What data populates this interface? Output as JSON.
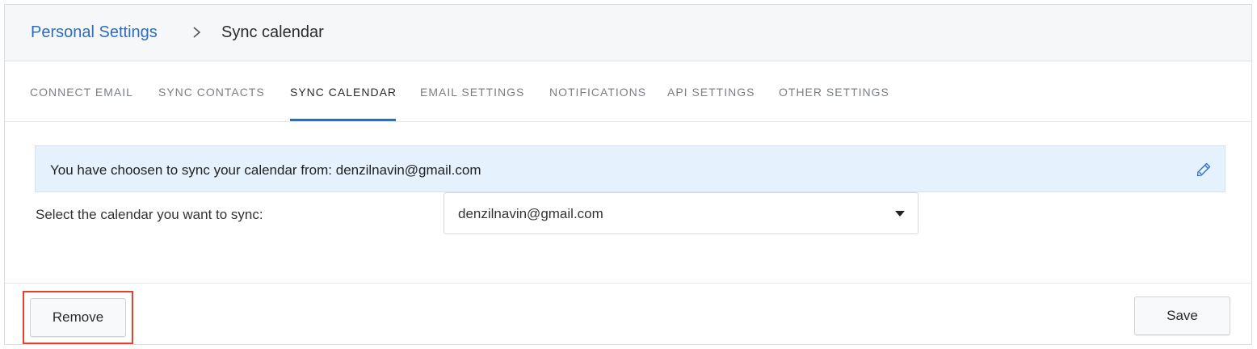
{
  "breadcrumb": {
    "parent_label": "Personal Settings",
    "current_label": "Sync calendar"
  },
  "tabs": [
    {
      "label": "CONNECT  EMAIL",
      "active": false
    },
    {
      "label": "SYNC  CONTACTS",
      "active": false
    },
    {
      "label": "SYNC  CALENDAR",
      "active": true
    },
    {
      "label": "EMAIL  SETTINGS",
      "active": false
    },
    {
      "label": "NOTIFICATIONS",
      "active": false
    },
    {
      "label": "API  SETTINGS",
      "active": false
    },
    {
      "label": "OTHER  SETTINGS",
      "active": false
    }
  ],
  "info": {
    "message": "You have choosen to sync your calendar from: denzilnavin@gmail.com",
    "edit_icon": "pencil-icon"
  },
  "calendar_select": {
    "label": "Select the calendar you want to sync:",
    "selected_value": "denzilnavin@gmail.com"
  },
  "footer": {
    "remove_label": "Remove",
    "save_label": "Save"
  },
  "colors": {
    "link": "#2d6cc0",
    "active_tab_underline": "#2d6cc0",
    "info_background": "#e5f1fc",
    "highlight": "#e8402b"
  }
}
